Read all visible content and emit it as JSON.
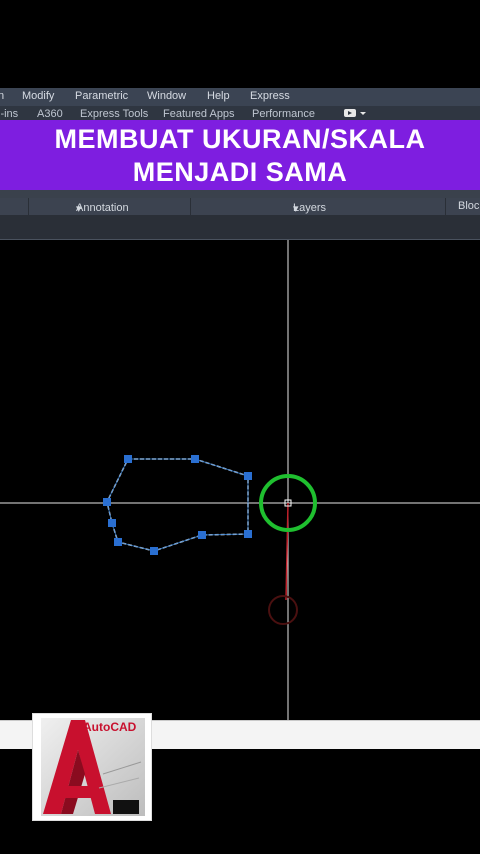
{
  "menubar": {
    "items": [
      "n",
      "Modify",
      "Parametric",
      "Window",
      "Help",
      "Express"
    ]
  },
  "ribbon_tabs": {
    "items": [
      "l-ins",
      "A360",
      "Express Tools",
      "Featured Apps",
      "Performance"
    ]
  },
  "banner": {
    "line1": "MEMBUAT UKURAN/SKALA",
    "line2": "MENJADI SAMA",
    "color": "#7e1ee0"
  },
  "panels": {
    "annotation": "Annotation",
    "layers": "Layers",
    "block": "Bloc"
  },
  "logo": {
    "text": "AutoCAD",
    "color": "#c8102e"
  },
  "colors": {
    "selection": "#3a86d8",
    "grip": "#2a6fd1",
    "cursor_circle": "#1fbf2f",
    "rubberband": "#c0202a"
  }
}
